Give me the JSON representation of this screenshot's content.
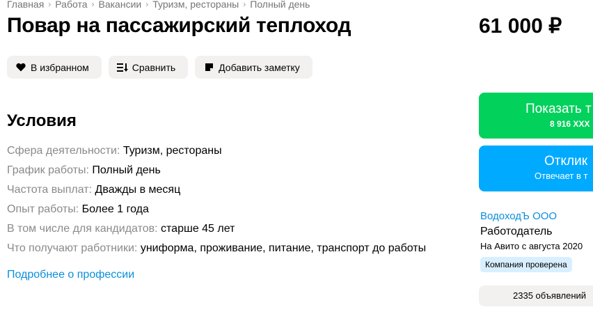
{
  "breadcrumb": [
    "Главная",
    "Работа",
    "Вакансии",
    "Туризм, рестораны",
    "Полный день"
  ],
  "title": "Повар на пассажирский теплоход",
  "price": "61 000 ₽",
  "actions": {
    "favorite": "В избранном",
    "compare": "Сравнить",
    "note": "Добавить заметку"
  },
  "conditions": {
    "heading": "Условия",
    "items": [
      {
        "key": "Сфера деятельности:",
        "value": "Туризм, рестораны"
      },
      {
        "key": "График работы:",
        "value": "Полный день"
      },
      {
        "key": "Частота выплат:",
        "value": "Дважды в месяц"
      },
      {
        "key": "Опыт работы:",
        "value": "Более 1 года"
      },
      {
        "key": "В том числе для кандидатов:",
        "value": "старше 45 лет"
      },
      {
        "key": "Что получают работники:",
        "value": "униформа, проживание, питание, транспорт до работы"
      }
    ],
    "more_link": "Подробнее о профессии"
  },
  "sidebar": {
    "phone_button": {
      "label": "Показать т",
      "phone": "8 916 XXX"
    },
    "respond_button": {
      "label": "Отклик",
      "sub": "Отвечает в т"
    },
    "company": {
      "name": "ВодоходЪ ООО",
      "role": "Работодатель",
      "since": "На Авито с августа 2020",
      "verified": "Компания проверена"
    },
    "listings": "2335 объявлений"
  },
  "colors": {
    "phone_button": "#02d15c",
    "respond_button": "#00aaff",
    "link": "#0a8fdc",
    "badge": "#d8efff",
    "action_bg": "#f2f1f0"
  }
}
